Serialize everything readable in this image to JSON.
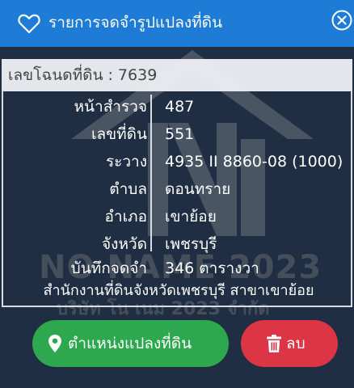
{
  "header": {
    "title": "รายการจดจำรูปแปลงที่ดิน",
    "favorite_icon": "heart-outline-icon",
    "close_icon": "circle-x-icon"
  },
  "deed": {
    "label": "เลขโฉนดที่ดิน : 7639"
  },
  "fields": [
    {
      "label": "หน้าสำรวจ",
      "value": "487"
    },
    {
      "label": "เลขที่ดิน",
      "value": "551"
    },
    {
      "label": "ระวาง",
      "value": "4935 II 8860-08 (1000)"
    },
    {
      "label": "ตำบล",
      "value": "ดอนทราย"
    },
    {
      "label": "อำเภอ",
      "value": "เขาย้อย"
    },
    {
      "label": "จังหวัด",
      "value": "เพชรบุรี"
    },
    {
      "label": "บันทึกจดจำ",
      "value": "346 ตารางวา"
    }
  ],
  "office": "สำนักงานที่ดินจังหวัดเพชรบุรี สาขาเขาย้อย",
  "watermark": {
    "line1": "NO NAME 2023",
    "line2": "บริษัท โน เนม 2023 จำกัด"
  },
  "buttons": {
    "locate_label": "ตำแหน่งแปลงที่ดิน",
    "delete_label": "ลบ"
  },
  "colors": {
    "header": "#1e7bd6",
    "background": "#1f2e42",
    "locate": "#2ea84f",
    "delete": "#dc3545"
  }
}
